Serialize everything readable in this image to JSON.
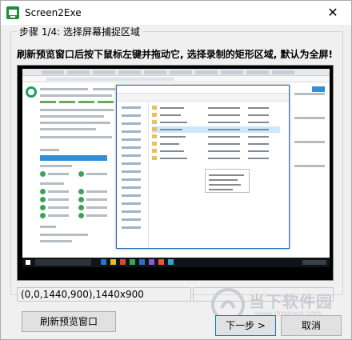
{
  "window": {
    "title": "Screen2Exe",
    "close_glyph": "✕"
  },
  "step": {
    "group_title": "步骤 1/4: 选择屏幕捕捉区域",
    "instruction": "刷新预览窗口后按下鼠标左键并拖动它, 选择录制的矩形区域, 默认为全屏!"
  },
  "status": {
    "coords": "(0,0,1440,900),1440x900"
  },
  "buttons": {
    "refresh": "刷新预览窗口",
    "next": "下一步 >",
    "cancel": "取消"
  },
  "watermark": {
    "name": "当下软件园",
    "url": "www.downxia.com"
  },
  "colors": {
    "accent": "#0078d7",
    "brand_green": "#18a05e",
    "watermark": "#c9ccd1"
  }
}
